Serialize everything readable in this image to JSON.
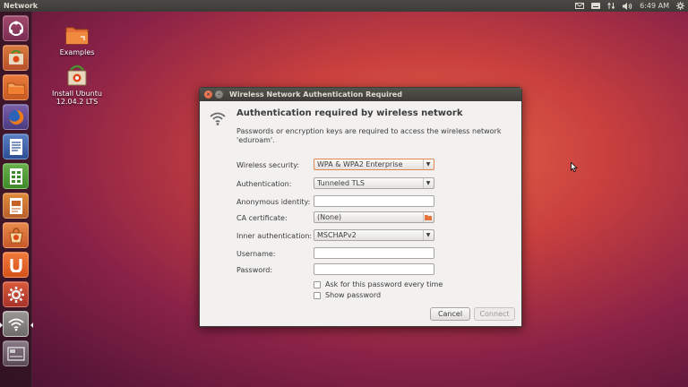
{
  "top_panel": {
    "app_title": "Network",
    "time": "6:49 AM",
    "icons": [
      "mail-icon",
      "keyboard-icon",
      "network-transfer-icon",
      "volume-icon",
      "gear-icon"
    ]
  },
  "launcher": {
    "items": [
      "dash-home-icon",
      "install-ubuntu-icon",
      "files-icon",
      "firefox-icon",
      "writer-icon",
      "calc-icon",
      "impress-icon",
      "software-center-icon",
      "ubuntu-one-icon",
      "system-settings-icon",
      "network-icon",
      "workspace-icon"
    ],
    "active_item": "network-icon"
  },
  "desktop": {
    "icons": [
      {
        "label": "Examples",
        "icon": "folder-icon"
      },
      {
        "label": "Install Ubuntu 12.04.2 LTS",
        "label_line1": "Install Ubuntu",
        "label_line2": "12.04.2 LTS",
        "icon": "installer-icon"
      }
    ]
  },
  "dialog": {
    "title": "Wireless Network Authentication Required",
    "heading": "Authentication required by wireless network",
    "description": "Passwords or encryption keys are required to access the wireless network 'eduroam'.",
    "fields": {
      "wireless_security": {
        "label": "Wireless security:",
        "value": "WPA & WPA2 Enterprise"
      },
      "authentication": {
        "label": "Authentication:",
        "value": "Tunneled TLS"
      },
      "anonymous_identity": {
        "label": "Anonymous identity:",
        "value": ""
      },
      "ca_certificate": {
        "label": "CA certificate:",
        "value": "(None)"
      },
      "inner_authentication": {
        "label": "Inner authentication:",
        "value": "MSCHAPv2"
      },
      "username": {
        "label": "Username:",
        "value": ""
      },
      "password": {
        "label": "Password:",
        "value": ""
      }
    },
    "checkboxes": {
      "ask_password": {
        "label": "Ask for this password every time",
        "checked": false
      },
      "show_password": {
        "label": "Show password",
        "checked": false
      }
    },
    "buttons": {
      "cancel": "Cancel",
      "connect": "Connect"
    }
  },
  "colors": {
    "panel_bg": "#3c3b37",
    "dialog_bg": "#f2f1f0",
    "accent_orange": "#e4864f",
    "close_button": "#e15a2f"
  }
}
